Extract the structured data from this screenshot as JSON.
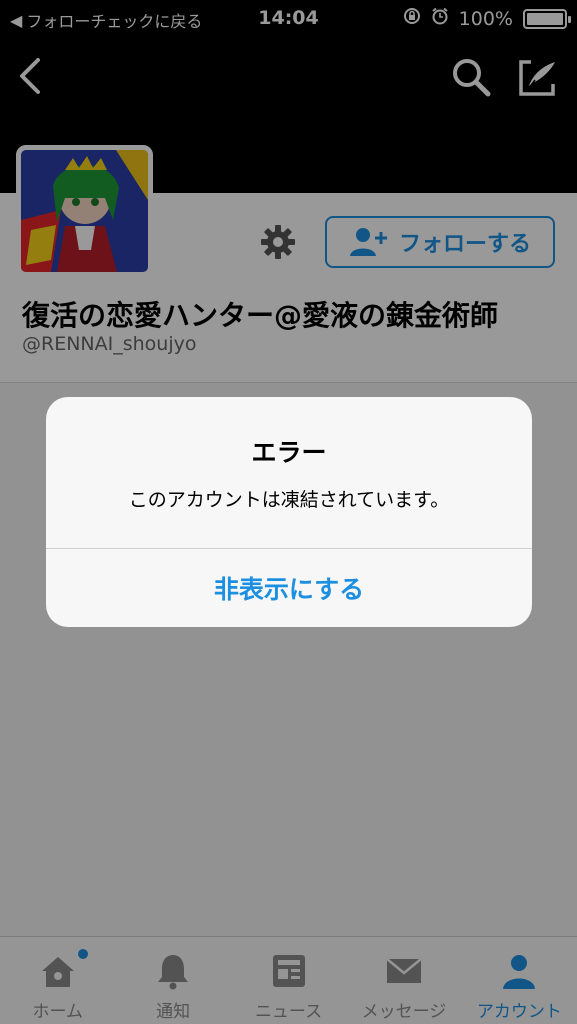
{
  "status_bar": {
    "back_app_label": "フォローチェックに戻る",
    "time": "14:04",
    "battery_percent": "100%",
    "battery_level": 1.0
  },
  "navbar": {
    "back_icon": "chevron-left-icon",
    "search_icon": "search-icon",
    "compose_icon": "compose-icon"
  },
  "profile": {
    "display_name": "復活の恋愛ハンター@愛液の錬金術師",
    "handle": "@RENNAI_shoujyo",
    "follow_button_label": "フォローする",
    "settings_icon": "gear-icon"
  },
  "alert": {
    "title": "エラー",
    "message": "このアカウントは凍結されています。",
    "action_label": "非表示にする"
  },
  "tabbar": {
    "items": [
      {
        "label": "ホーム",
        "icon": "home-icon",
        "badge": true
      },
      {
        "label": "通知",
        "icon": "bell-icon"
      },
      {
        "label": "ニュース",
        "icon": "news-icon"
      },
      {
        "label": "メッセージ",
        "icon": "envelope-icon"
      },
      {
        "label": "アカウント",
        "icon": "person-icon",
        "active": true
      }
    ]
  },
  "colors": {
    "accent": "#1d8fe1",
    "overlay": "rgba(0,0,0,0.40)"
  }
}
